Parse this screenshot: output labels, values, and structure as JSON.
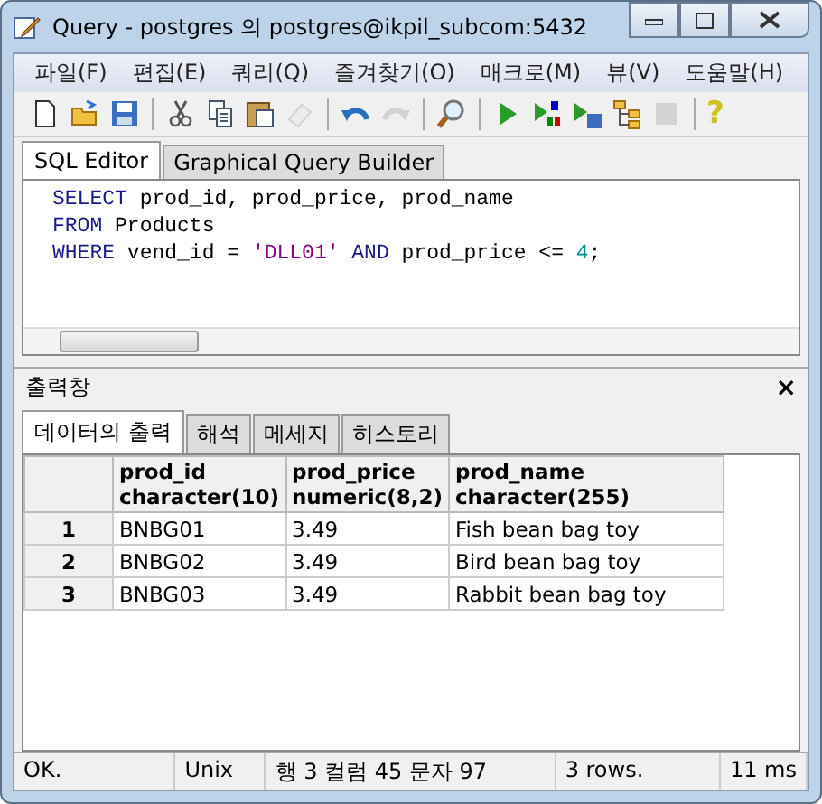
{
  "window": {
    "title": "Query - postgres 의 postgres@ikpil_subcom:5432"
  },
  "menu": [
    "파일(F)",
    "편집(E)",
    "쿼리(Q)",
    "즐겨찾기(O)",
    "매크로(M)",
    "뷰(V)",
    "도움말(H)"
  ],
  "toolbar": [
    {
      "kind": "new",
      "disabled": false
    },
    {
      "kind": "open",
      "disabled": false
    },
    {
      "kind": "save",
      "disabled": false
    },
    {
      "kind": "separator"
    },
    {
      "kind": "cut",
      "disabled": false
    },
    {
      "kind": "copy",
      "disabled": false
    },
    {
      "kind": "paste",
      "disabled": false
    },
    {
      "kind": "eraser",
      "disabled": true
    },
    {
      "kind": "separator"
    },
    {
      "kind": "undo",
      "disabled": false
    },
    {
      "kind": "redo",
      "disabled": true
    },
    {
      "kind": "separator"
    },
    {
      "kind": "search",
      "disabled": false
    },
    {
      "kind": "separator"
    },
    {
      "kind": "run",
      "disabled": false
    },
    {
      "kind": "run-pgs",
      "disabled": false
    },
    {
      "kind": "run-save",
      "disabled": false
    },
    {
      "kind": "explain",
      "disabled": false
    },
    {
      "kind": "stop",
      "disabled": true
    },
    {
      "kind": "separator"
    },
    {
      "kind": "help",
      "disabled": false,
      "glyph": "?"
    }
  ],
  "editor_tabs": [
    {
      "label": "SQL Editor",
      "selected": true
    },
    {
      "label": "Graphical Query Builder",
      "selected": false
    }
  ],
  "sql_lines": [
    [
      {
        "kind": "keyword",
        "text": "SELECT"
      },
      {
        "kind": "plain",
        "text": " prod_id, prod_price, prod_name"
      }
    ],
    [
      {
        "kind": "keyword",
        "text": "FROM"
      },
      {
        "kind": "plain",
        "text": " Products"
      }
    ],
    [
      {
        "kind": "keyword",
        "text": "WHERE"
      },
      {
        "kind": "plain",
        "text": " vend_id = "
      },
      {
        "kind": "string",
        "text": "'DLL01'"
      },
      {
        "kind": "keyword",
        "text": " AND"
      },
      {
        "kind": "plain",
        "text": " prod_price <= "
      },
      {
        "kind": "number",
        "text": "4"
      },
      {
        "kind": "plain",
        "text": ";"
      }
    ]
  ],
  "output_panel": {
    "title": "출력창",
    "close": "×",
    "tabs": [
      {
        "label": "데이터의 출력",
        "selected": true
      },
      {
        "label": "해석",
        "selected": false
      },
      {
        "label": "메세지",
        "selected": false
      },
      {
        "label": "히스토리",
        "selected": false
      }
    ],
    "columns": [
      {
        "name": "prod_id",
        "type": "character(10)"
      },
      {
        "name": "prod_price",
        "type": "numeric(8,2)"
      },
      {
        "name": "prod_name",
        "type": "character(255)"
      }
    ],
    "rows": [
      {
        "number": "1",
        "cells": [
          "BNBG01",
          "3.49",
          "Fish bean bag toy"
        ]
      },
      {
        "number": "2",
        "cells": [
          "BNBG02",
          "3.49",
          "Bird bean bag toy"
        ]
      },
      {
        "number": "3",
        "cells": [
          "BNBG03",
          "3.49",
          "Rabbit bean bag toy"
        ]
      }
    ]
  },
  "status_bar": [
    "OK.",
    "Unix",
    "행 3 컬럼 45 문자 97",
    "3 rows.",
    "11 ms"
  ]
}
